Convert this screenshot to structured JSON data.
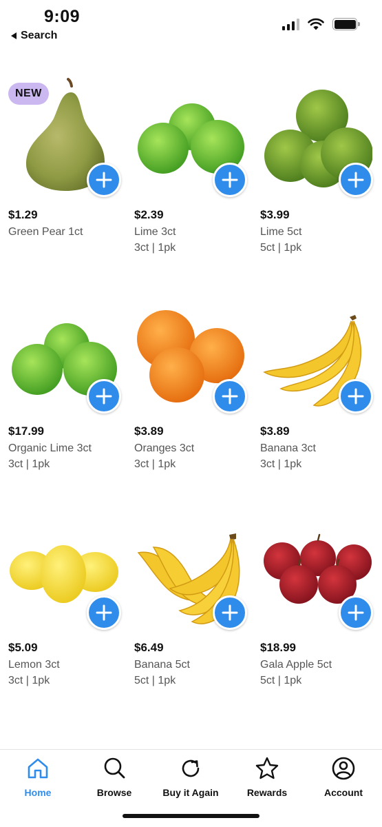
{
  "status_bar": {
    "time": "9:09",
    "back_label": "Search"
  },
  "products": [
    {
      "price": "$1.29",
      "name": "Green Pear 1ct",
      "size": "",
      "badge": "NEW",
      "icon": "pear"
    },
    {
      "price": "$2.39",
      "name": "Lime 3ct",
      "size": "3ct | 1pk",
      "badge": "",
      "icon": "lime-3"
    },
    {
      "price": "$3.99",
      "name": "Lime 5ct",
      "size": "5ct | 1pk",
      "badge": "",
      "icon": "lime-5"
    },
    {
      "price": "$17.99",
      "name": "Organic Lime 3ct",
      "size": "3ct | 1pk",
      "badge": "",
      "icon": "organic-lime"
    },
    {
      "price": "$3.89",
      "name": "Oranges 3ct",
      "size": "3ct | 1pk",
      "badge": "",
      "icon": "oranges"
    },
    {
      "price": "$3.89",
      "name": "Banana 3ct",
      "size": "3ct | 1pk",
      "badge": "",
      "icon": "banana-3"
    },
    {
      "price": "$5.09",
      "name": "Lemon 3ct",
      "size": "3ct | 1pk",
      "badge": "",
      "icon": "lemons"
    },
    {
      "price": "$6.49",
      "name": "Banana 5ct",
      "size": "5ct | 1pk",
      "badge": "",
      "icon": "banana-5"
    },
    {
      "price": "$18.99",
      "name": "Gala Apple 5ct",
      "size": "5ct | 1pk",
      "badge": "",
      "icon": "apples"
    }
  ],
  "tabs": [
    {
      "label": "Home",
      "icon": "home-icon",
      "active": true
    },
    {
      "label": "Browse",
      "icon": "search-icon",
      "active": false
    },
    {
      "label": "Buy it Again",
      "icon": "refresh-icon",
      "active": false
    },
    {
      "label": "Rewards",
      "icon": "star-icon",
      "active": false
    },
    {
      "label": "Account",
      "icon": "account-icon",
      "active": false
    }
  ],
  "colors": {
    "accent": "#2f8ceb",
    "badge": "#cbb8f0"
  }
}
